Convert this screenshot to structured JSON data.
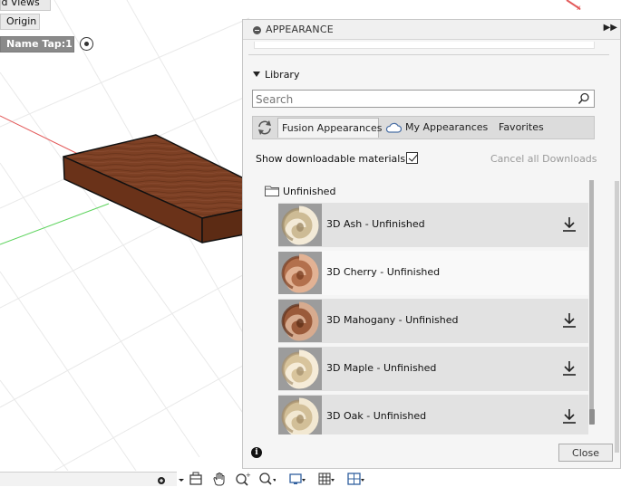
{
  "browser": {
    "named_views": "Named Views",
    "origin": "Origin",
    "name_tap": "Name Tap:1"
  },
  "panel": {
    "title": "APPEARANCE",
    "library_label": "Library",
    "search_placeholder": "Search",
    "tabs": [
      {
        "label": "Fusion Appearances",
        "active": true
      },
      {
        "label": "My Appearances",
        "active": false
      },
      {
        "label": "Favorites",
        "active": false
      }
    ],
    "show_downloadable_label": "Show downloadable materials",
    "show_downloadable_checked": true,
    "cancel_downloads_label": "Cancel all Downloads",
    "folder_label": "Unfinished",
    "materials": [
      {
        "label": "3D Ash - Unfinished",
        "downloadable": true,
        "tone": "ash"
      },
      {
        "label": "3D Cherry - Unfinished",
        "downloadable": false,
        "tone": "cherry"
      },
      {
        "label": "3D Mahogany - Unfinished",
        "downloadable": true,
        "tone": "mahogany"
      },
      {
        "label": "3D Maple - Unfinished",
        "downloadable": true,
        "tone": "maple"
      },
      {
        "label": "3D Oak - Unfinished",
        "downloadable": true,
        "tone": "oak"
      }
    ],
    "close_label": "Close"
  },
  "icons": {
    "search": "magnifier-icon",
    "refresh": "refresh-icon",
    "cloud": "cloud-icon",
    "folder": "folder-icon",
    "download": "download-icon",
    "info": "info-icon"
  },
  "colors": {
    "wood_top": "#7c3f23",
    "wood_side": "#6a3219",
    "axis_x": "#e35a5a",
    "axis_y": "#5bd35b"
  }
}
